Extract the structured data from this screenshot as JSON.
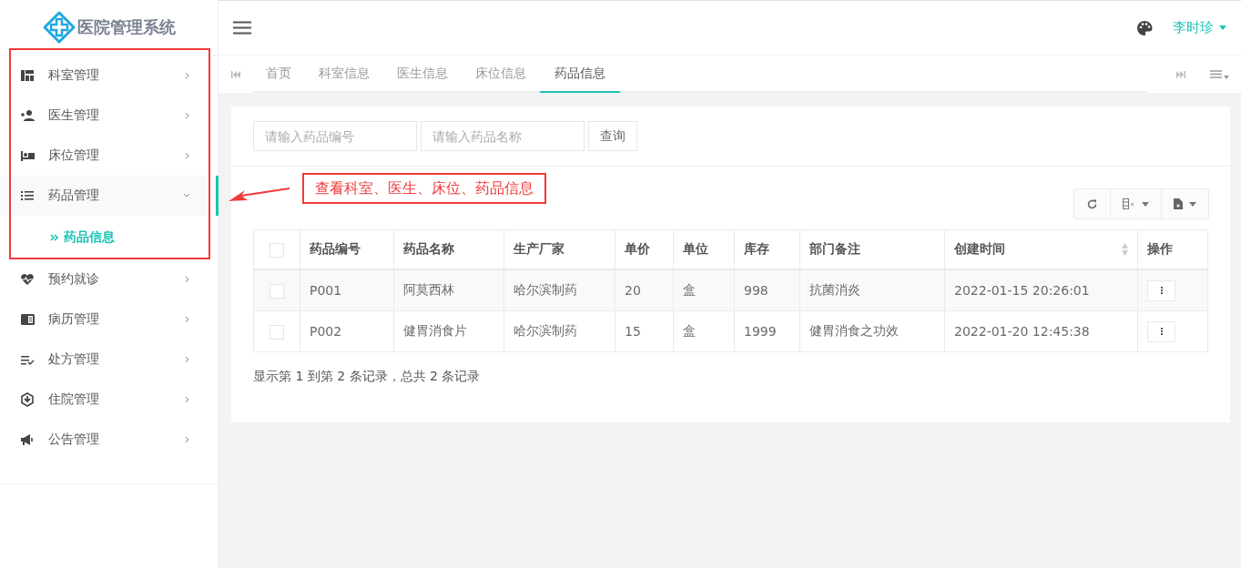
{
  "sidebar": {
    "logo": "医院管理系统",
    "items": [
      {
        "label": "科室管理",
        "expanded": false
      },
      {
        "label": "医生管理",
        "expanded": false
      },
      {
        "label": "床位管理",
        "expanded": false
      },
      {
        "label": "药品管理",
        "expanded": true,
        "children": [
          {
            "label": "药品信息",
            "selected": true
          }
        ]
      },
      {
        "label": "预约就诊",
        "expanded": false
      },
      {
        "label": "病历管理",
        "expanded": false
      },
      {
        "label": "处方管理",
        "expanded": false
      },
      {
        "label": "住院管理",
        "expanded": false
      },
      {
        "label": "公告管理",
        "expanded": false
      }
    ]
  },
  "header": {
    "user": "李时珍"
  },
  "tabs": [
    {
      "label": "首页",
      "selected": false
    },
    {
      "label": "科室信息",
      "selected": false
    },
    {
      "label": "医生信息",
      "selected": false
    },
    {
      "label": "床位信息",
      "selected": false
    },
    {
      "label": "药品信息",
      "selected": true
    }
  ],
  "search": {
    "fields": [
      {
        "placeholder": "请输入药品编号"
      },
      {
        "placeholder": "请输入药品名称"
      }
    ],
    "button": "查询"
  },
  "annotation": "查看科室、医生、床位、药品信息",
  "table": {
    "all_checked": false,
    "columns": [
      {
        "label": "药品编号",
        "sortable": false
      },
      {
        "label": "药品名称",
        "sortable": false
      },
      {
        "label": "生产厂家",
        "sortable": false
      },
      {
        "label": "单价",
        "sortable": false
      },
      {
        "label": "单位",
        "sortable": false
      },
      {
        "label": "库存",
        "sortable": false
      },
      {
        "label": "部门备注",
        "sortable": false
      },
      {
        "label": "创建时间",
        "sortable": true
      },
      {
        "label": "操作",
        "sortable": false
      }
    ],
    "rows": [
      {
        "checked": false,
        "cells": [
          "P001",
          "阿莫西林",
          "哈尔滨制药",
          "20",
          "盒",
          "998",
          "抗菌消炎",
          "2022-01-15 20:26:01"
        ]
      },
      {
        "checked": false,
        "cells": [
          "P002",
          "健胃消食片",
          "哈尔滨制药",
          "15",
          "盒",
          "1999",
          "健胃消食之功效",
          "2022-01-20 12:45:38"
        ]
      }
    ]
  },
  "footer": "显示第 1 到第 2 条记录，总共 2 条记录"
}
